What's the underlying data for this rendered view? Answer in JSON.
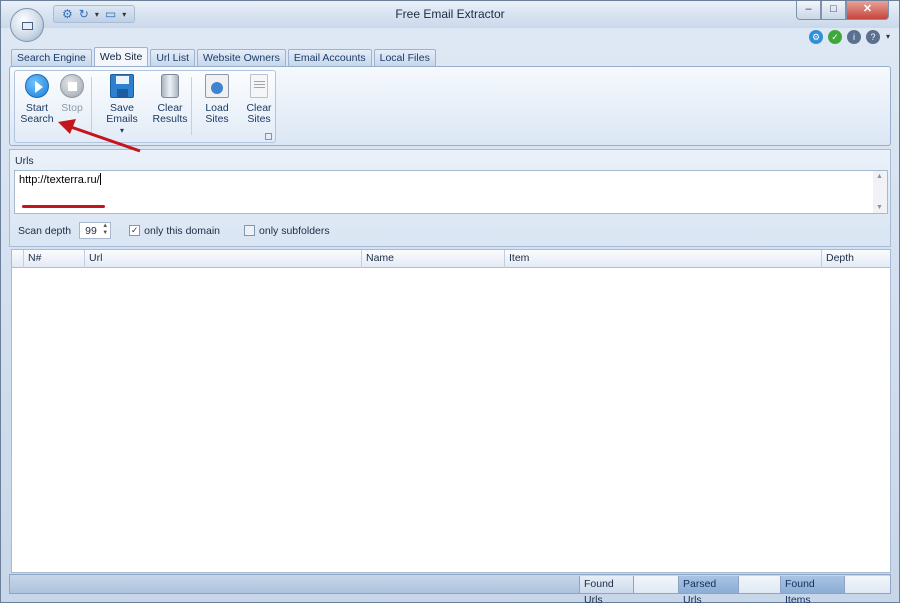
{
  "window": {
    "title": "Free Email Extractor",
    "minimize_glyph": "–",
    "maximize_glyph": "□",
    "close_glyph": "✕"
  },
  "quick_access": {
    "icons": [
      "gear-icon",
      "refresh-icon",
      "screen-icon"
    ]
  },
  "tabs": [
    {
      "label": "Search Engine",
      "active": false
    },
    {
      "label": "Web Site",
      "active": true
    },
    {
      "label": "Url List",
      "active": false
    },
    {
      "label": "Website Owners",
      "active": false
    },
    {
      "label": "Email Accounts",
      "active": false
    },
    {
      "label": "Local Files",
      "active": false
    }
  ],
  "ribbon": {
    "start": {
      "line1": "Start",
      "line2": "Search",
      "icon": "play-icon"
    },
    "stop": {
      "line1": "Stop",
      "icon": "stop-icon",
      "disabled": true
    },
    "save": {
      "line1": "Save Emails",
      "dropdown": "▾",
      "icon": "save-icon"
    },
    "clear_results": {
      "line1": "Clear",
      "line2": "Results",
      "icon": "trash-icon"
    },
    "load_sites": {
      "line1": "Load Sites",
      "icon": "clipboard-icon"
    },
    "clear_sites": {
      "line1": "Clear",
      "line2": "Sites",
      "icon": "document-icon"
    }
  },
  "urls": {
    "label": "Urls",
    "value": "http://texterra.ru/"
  },
  "scan": {
    "depth_label": "Scan depth",
    "depth_value": "99",
    "only_domain_label": "only this domain",
    "only_domain_checked": true,
    "only_subfolders_label": "only subfolders",
    "only_subfolders_checked": false
  },
  "grid": {
    "columns": [
      "N#",
      "Url",
      "Name",
      "Item",
      "Depth"
    ],
    "rows": []
  },
  "status": {
    "found_urls_label": "Found Urls",
    "found_urls_value": "",
    "parsed_urls_label": "Parsed Urls",
    "parsed_urls_value": "",
    "found_items_label": "Found Items",
    "found_items_value": ""
  },
  "colors": {
    "annotation_red": "#c4141c",
    "accent_blue": "#2d7fd0"
  }
}
